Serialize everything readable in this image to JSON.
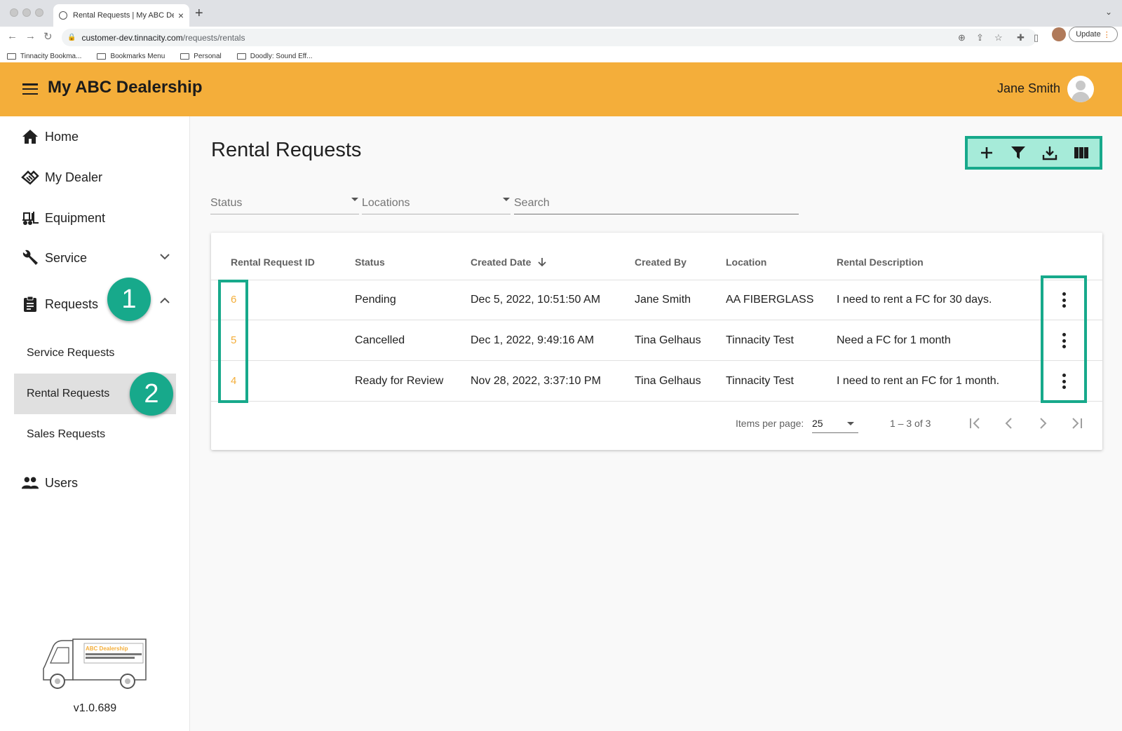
{
  "browser": {
    "tab_title": "Rental Requests | My ABC Dea",
    "url_domain": "customer-dev.tinnacity.com",
    "url_path": "/requests/rentals",
    "update_label": "Update",
    "bookmarks": [
      "Tinnacity Bookma...",
      "Bookmarks Menu",
      "Personal",
      "Doodly: Sound Eff..."
    ]
  },
  "header": {
    "title": "My ABC Dealership",
    "user_name": "Jane Smith",
    "bg_color": "#f4ae3a"
  },
  "sidebar": {
    "items": [
      {
        "label": "Home",
        "icon": "home-icon"
      },
      {
        "label": "My Dealer",
        "icon": "handshake-icon"
      },
      {
        "label": "Equipment",
        "icon": "forklift-icon"
      },
      {
        "label": "Service",
        "icon": "wrench-icon"
      },
      {
        "label": "Requests",
        "icon": "clipboard-icon"
      },
      {
        "label": "Users",
        "icon": "people-icon"
      }
    ],
    "sub_items": [
      "Service Requests",
      "Rental Requests",
      "Sales Requests"
    ],
    "active_sub_item": "Rental Requests",
    "badge_1": "1",
    "badge_2": "2",
    "logo_text": "ABC Dealership",
    "version": "v1.0.689"
  },
  "main": {
    "page_title": "Rental Requests",
    "toolbar": {
      "icons": [
        "add-icon",
        "filter-icon",
        "download-icon",
        "columns-icon"
      ]
    },
    "filters": {
      "status_label": "Status",
      "locations_label": "Locations",
      "search_placeholder": "Search"
    },
    "table": {
      "columns": [
        "Rental Request ID",
        "Status",
        "Created Date",
        "Created By",
        "Location",
        "Rental Description"
      ],
      "sort_column": "Created Date",
      "rows": [
        {
          "id": "6",
          "status": "Pending",
          "created_date": "Dec 5, 2022, 10:51:50 AM",
          "created_by": "Jane Smith",
          "location": "AA FIBERGLASS",
          "description": "I need to rent a FC for 30 days."
        },
        {
          "id": "5",
          "status": "Cancelled",
          "created_date": "Dec 1, 2022, 9:49:16 AM",
          "created_by": "Tina Gelhaus",
          "location": "Tinnacity Test",
          "description": "Need a FC for 1 month"
        },
        {
          "id": "4",
          "status": "Ready for Review",
          "created_date": "Nov 28, 2022, 3:37:10 PM",
          "created_by": "Tina Gelhaus",
          "location": "Tinnacity Test",
          "description": "I need to rent an FC for 1 month."
        }
      ]
    },
    "paginator": {
      "items_per_page_label": "Items per page:",
      "items_per_page": "25",
      "range_label": "1 – 3 of 3"
    }
  },
  "colors": {
    "accent": "#f4ae3a",
    "highlight": "#17a98b",
    "link": "#f4ae3a"
  }
}
